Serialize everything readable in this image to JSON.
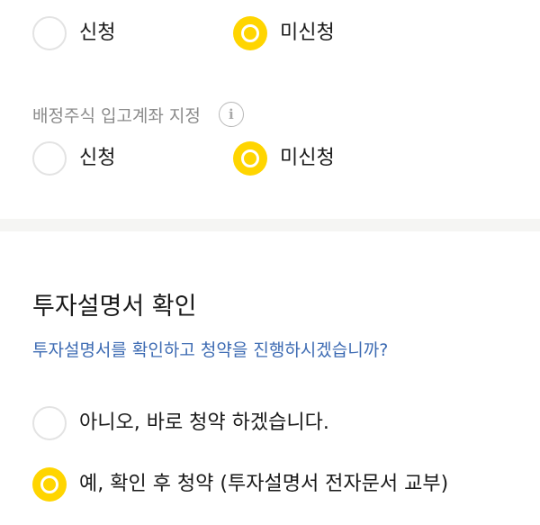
{
  "allotment_notice": {
    "options": [
      {
        "label": "신청",
        "checked": false
      },
      {
        "label": "미신청",
        "checked": true
      }
    ]
  },
  "allotted_stock_account": {
    "label": "배정주식 입고계좌 지정",
    "info_icon": "info-icon",
    "options": [
      {
        "label": "신청",
        "checked": false
      },
      {
        "label": "미신청",
        "checked": true
      }
    ]
  },
  "prospectus": {
    "title": "투자설명서 확인",
    "question": "투자설명서를 확인하고 청약을 진행하시겠습니까?",
    "options": [
      {
        "label": "아니오, 바로 청약 하겠습니다.",
        "checked": false
      },
      {
        "label": "예, 확인 후 청약 (투자설명서 전자문서 교부)",
        "checked": true
      }
    ]
  },
  "colors": {
    "accent": "#ffd500",
    "link": "#3d6bb3",
    "muted": "#8a8a8a",
    "divider": "#f5f5f3"
  }
}
